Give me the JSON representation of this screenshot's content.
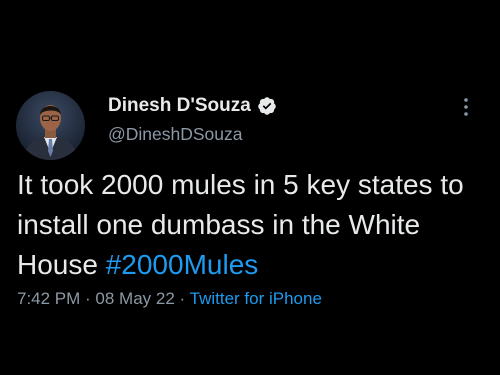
{
  "theme": {
    "background": "#000000",
    "text_primary": "#e7e9ea",
    "text_secondary": "#8b98a5",
    "accent": "#1d9bf0"
  },
  "author": {
    "display_name": "Dinesh D'Souza",
    "handle": "@DineshDSouza",
    "verified": true,
    "verified_icon": "verified-badge-icon",
    "avatar": "profile-photo"
  },
  "tweet": {
    "text_before": "It took 2000 mules in 5 key states to install one dumbass in the White House ",
    "hashtag": "#2000Mules"
  },
  "meta": {
    "time": "7:42 PM",
    "separator": " · ",
    "date": "08 May 22",
    "source": "Twitter for iPhone"
  },
  "actions": {
    "more_icon": "more-vertical-icon"
  }
}
